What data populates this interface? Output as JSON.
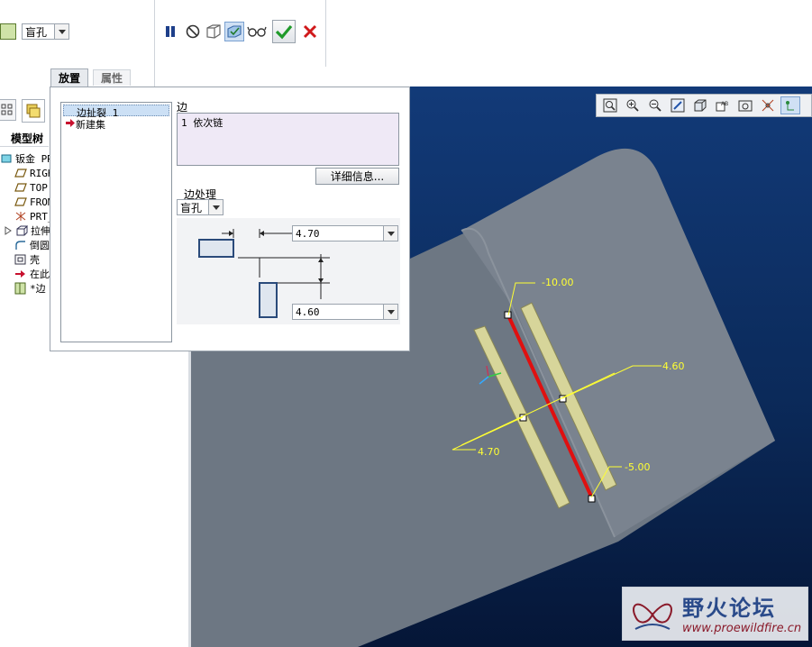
{
  "ribbon": {
    "relief_type": "盲孔",
    "tabs": [
      "放置",
      "属性"
    ],
    "buttons": [
      "pause",
      "no-preview",
      "geometry-preview",
      "verify-preview",
      "glasses",
      "ok",
      "cancel"
    ]
  },
  "model_tree": {
    "header": "模型树",
    "items": [
      {
        "label": "钣金 PR",
        "icon": "sheetmetal-part-icon"
      },
      {
        "label": "RIGH",
        "icon": "datum-plane-icon"
      },
      {
        "label": "TOP",
        "icon": "datum-plane-icon"
      },
      {
        "label": "FROM",
        "icon": "datum-plane-icon"
      },
      {
        "label": "PRT_",
        "icon": "csys-icon"
      },
      {
        "label": "拉伸",
        "icon": "extrude-icon"
      },
      {
        "label": "倒圆",
        "icon": "round-icon"
      },
      {
        "label": "壳",
        "icon": "shell-icon"
      },
      {
        "label": "在此",
        "icon": "insert-arrow-icon"
      },
      {
        "label": "*边",
        "icon": "edge-rip-icon"
      }
    ]
  },
  "placement": {
    "sets": [
      "边扯裂 1",
      "新建集"
    ],
    "edge_label": "边",
    "edge_value": "1 依次链",
    "details_button": "详细信息...",
    "treatment_label": "边处理",
    "treatment_value": "盲孔",
    "dim1": "4.70",
    "dim2": "4.60"
  },
  "viewport": {
    "annotations": [
      "-10.00",
      "4.60",
      "4.70",
      "-5.00"
    ],
    "toolbar_icons": [
      "zoom-fit-icon",
      "zoom-in-icon",
      "zoom-out-icon",
      "repaint-icon",
      "display-style-icon",
      "saved-views-icon",
      "view-manager-icon",
      "datum-display-icon",
      "spin-center-icon"
    ]
  },
  "watermark": {
    "title": "野火论坛",
    "url": "www.proewildfire.cn"
  },
  "colors": {
    "viewport_top": "#123a78",
    "viewport_bottom": "#051637",
    "model_face": "#6d7783",
    "rip_edge": "#e01010",
    "dimension": "#ffff33",
    "ok_green": "#1f9a2a",
    "cancel_red": "#d0191b",
    "pause_blue": "#1e3f8a"
  }
}
